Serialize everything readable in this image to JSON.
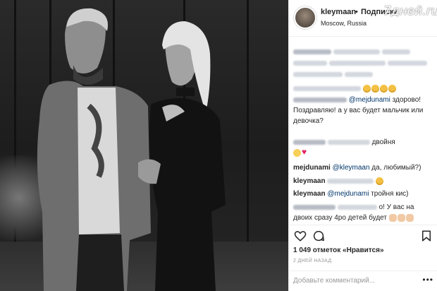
{
  "header": {
    "username": "kleymaan",
    "separator": "•",
    "follow_label": "Подписки",
    "location": "Moscow, Russia"
  },
  "watermark": "7дней.ru",
  "comments": {
    "c3_text": "@mejdunami здорово! Поздравляю! а у вас будет мальчик или девочка?",
    "c3_mention": "@mejdunami",
    "c3_body": " здорово! Поздравляю! а у вас будет мальчик или девочка?",
    "c4_text": "двойня",
    "c5_user": "mejdunami",
    "c5_mention": "@kleymaan",
    "c5_text": " да, любимый?)",
    "c6_user": "kleymaan",
    "c7_user": "kleymaan",
    "c7_mention": "@mejdunami",
    "c7_text": " тройня кис)",
    "c8_text": "о! У вас на двоих сразу 4ро детей будет"
  },
  "footer": {
    "likes": "1 049 отметок «Нравится»",
    "time": "2 ДНЕЙ НАЗАД",
    "add_placeholder": "Добавьте комментарий...",
    "more": "•••"
  },
  "icons": [
    "heart-icon",
    "comment-icon",
    "bookmark-icon"
  ]
}
